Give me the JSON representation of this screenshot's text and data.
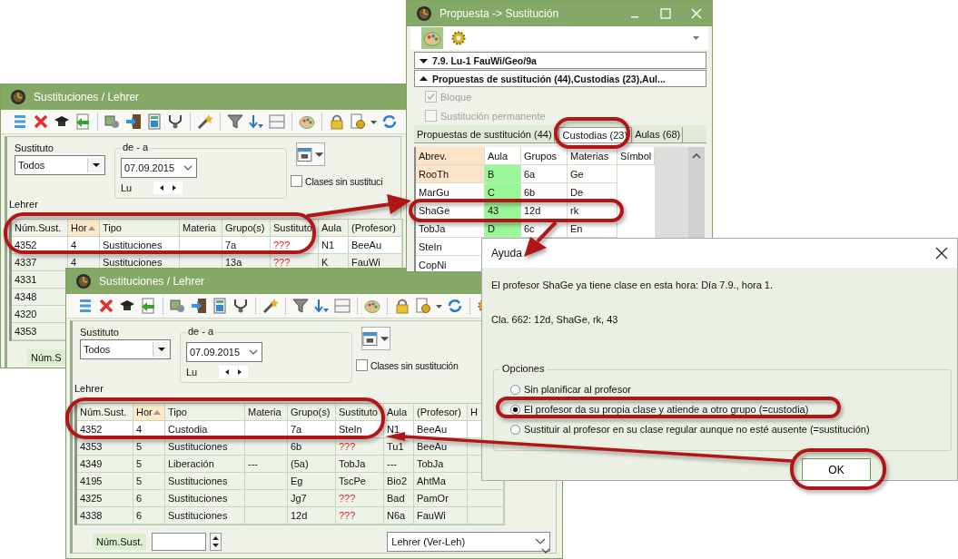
{
  "main_windows": [
    {
      "title": "Sustituciones / Lehrer",
      "substitute_label": "Sustituto",
      "substitute_value": "Todos",
      "range_label": "de - a",
      "date": "07.09.2015",
      "weekday": "Lu",
      "checkbox": {
        "label": "Clases sin sustituci",
        "checked": false
      },
      "list_label": "Lehrer",
      "columns": [
        {
          "label": "Núm.Sust.",
          "sorted": false
        },
        {
          "label": "Hor",
          "sorted": true
        },
        {
          "label": "Tipo",
          "sorted": false
        },
        {
          "label": "Materia",
          "sorted": false
        },
        {
          "label": "Grupo(s)",
          "sorted": false
        },
        {
          "label": "Sustituto",
          "sorted": false
        },
        {
          "label": "Aula",
          "sorted": false
        },
        {
          "label": "(Profesor)",
          "sorted": false
        }
      ],
      "rows": [
        {
          "id": "4352",
          "hour": "4",
          "type": "Sustituciones",
          "group": "7a",
          "substitute": "???",
          "room": "N1",
          "teacher": "BeeAu",
          "selected": true,
          "substitute_missing": true
        },
        {
          "id": "4337",
          "hour": "4",
          "type": "Sustituciones",
          "group": "13a",
          "substitute": "???",
          "room": "K",
          "teacher": "FauWi",
          "selected": false,
          "substitute_missing": true
        },
        {
          "id": "4331",
          "selected": false
        },
        {
          "id": "4348",
          "selected": false
        },
        {
          "id": "4320",
          "selected": false
        },
        {
          "id": "4353",
          "selected": false
        }
      ],
      "footer": {
        "label": "Núm.S"
      }
    },
    {
      "title": "Sustituciones / Lehrer",
      "substitute_label": "Sustituto",
      "substitute_value": "Todos",
      "range_label": "de - a",
      "date": "07.09.2015",
      "weekday": "Lu",
      "checkbox": {
        "label": "Clases sin sustitución",
        "checked": false
      },
      "list_label": "Lehrer",
      "columns": [
        {
          "label": "Núm.Sust.",
          "sorted": false
        },
        {
          "label": "Hor",
          "sorted": true
        },
        {
          "label": "Tipo",
          "sorted": false
        },
        {
          "label": "Materia",
          "sorted": false
        },
        {
          "label": "Grupo(s)",
          "sorted": false
        },
        {
          "label": "Sustituto",
          "sorted": false
        },
        {
          "label": "Aula",
          "sorted": false
        },
        {
          "label": "(Profesor)",
          "sorted": false
        },
        {
          "label": "H",
          "sorted": false
        }
      ],
      "rows": [
        {
          "id": "4352",
          "hour": "4",
          "type": "Custodia",
          "group": "7a",
          "substitute": "SteIn",
          "room": "N1",
          "teacher": "BeeAu",
          "selected": true,
          "substitute_missing": false
        },
        {
          "id": "4353",
          "hour": "5",
          "type": "Sustituciones",
          "group": "6b",
          "substitute": "???",
          "room": "Tu1",
          "teacher": "BeeAu",
          "selected": false,
          "substitute_missing": true
        },
        {
          "id": "4349",
          "hour": "5",
          "type": "Liberación",
          "subject": "---",
          "group": "(5a)",
          "substitute": "TobJa",
          "room": "---",
          "teacher": "TobJa",
          "selected": false,
          "substitute_missing": false
        },
        {
          "id": "4195",
          "hour": "5",
          "type": "Sustituciones",
          "group": "Eg",
          "substitute": "TscPe",
          "room": "Bio2",
          "teacher": "AhtMa",
          "selected": false,
          "substitute_missing": false
        },
        {
          "id": "4325",
          "hour": "6",
          "type": "Sustituciones",
          "group": "Jg7",
          "substitute": "???",
          "room": "Bad",
          "teacher": "PamOr",
          "selected": false,
          "substitute_missing": true
        },
        {
          "id": "4338",
          "hour": "6",
          "type": "Sustituciones",
          "group": "12d",
          "substitute": "???",
          "room": "N6a",
          "teacher": "FauWi",
          "selected": false,
          "substitute_missing": true
        }
      ],
      "footer": {
        "label": "Núm.Sust.",
        "view": "Lehrer (Ver-Leh)"
      }
    }
  ],
  "proposal_window": {
    "title": "Propuesta -> Sustitución",
    "tools": [
      {
        "kind": "palette",
        "selected": true
      },
      {
        "kind": "gear",
        "selected": false
      }
    ],
    "sections": [
      {
        "label": "7.9. Lu-1 FauWi/Geo/9a",
        "expanded": false
      },
      {
        "label": "Propuestas de sustitución (44),Custodias (23),Aul...",
        "expanded": true
      }
    ],
    "options": [
      {
        "label": "Bloque",
        "checked": true,
        "disabled": true
      },
      {
        "label": "Sustitución permanente",
        "checked": false,
        "disabled": true
      }
    ],
    "tabs": [
      {
        "label": "Propuestas de sustitución (44)",
        "selected": false
      },
      {
        "label": "Custodias (23)",
        "selected": true
      },
      {
        "label": "Aulas (68)",
        "selected": false
      }
    ],
    "columns": [
      "Abrev.",
      "Aula",
      "Grupos",
      "Materias",
      "Símbol"
    ],
    "rows": [
      {
        "cells": [
          "RooTh",
          "B",
          "6a",
          "Ge"
        ],
        "selected": true
      },
      {
        "cells": [
          "MarGu",
          "C",
          "6b",
          "De"
        ],
        "selected": false
      },
      {
        "cells": [
          "ShaGe",
          "43",
          "12d",
          "rk"
        ],
        "selected": false
      },
      {
        "cells": [
          "TobJa",
          "D",
          "6c",
          "En"
        ],
        "selected": false
      },
      {
        "cells": [
          "SteIn"
        ],
        "selected": false
      },
      {
        "cells": [
          "CopNi"
        ],
        "selected": false
      }
    ]
  },
  "help_dialog": {
    "title": "Ayuda",
    "message": "El profesor ShaGe ya tiene clase en esta hora: Día 7.9., hora 1.",
    "detail": "Cla. 662: 12d, ShaGe, rk, 43",
    "group_label": "Opciones",
    "options": [
      {
        "label": "Sin planificar al profesor",
        "selected": false
      },
      {
        "label": "El profesor da su propia clase y atiende a otro grupo (=custodia)",
        "selected": true
      },
      {
        "label": "Sustituir al profesor en su clase regular aunque no esté ausente (=sustitución)",
        "selected": false
      }
    ],
    "button": "OK"
  }
}
